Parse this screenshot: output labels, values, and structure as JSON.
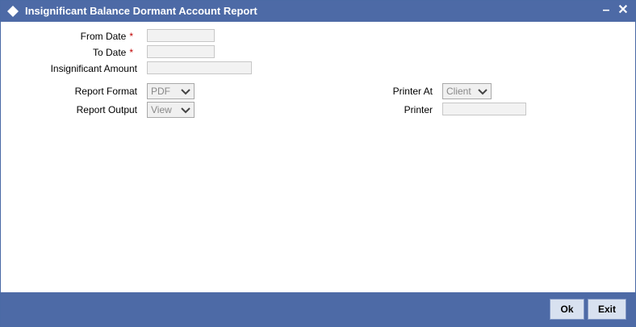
{
  "window": {
    "title": "Insignificant Balance Dormant Account Report",
    "minimize_glyph": "–",
    "close_glyph": "✕"
  },
  "form": {
    "from_date": {
      "label": "From Date",
      "required_mark": "*",
      "value": ""
    },
    "to_date": {
      "label": "To Date",
      "required_mark": "*",
      "value": ""
    },
    "insignificant_amount": {
      "label": "Insignificant Amount",
      "value": ""
    },
    "report_format": {
      "label": "Report Format",
      "selected": "PDF"
    },
    "report_output": {
      "label": "Report Output",
      "selected": "View"
    },
    "printer_at": {
      "label": "Printer At",
      "selected": "Client"
    },
    "printer": {
      "label": "Printer",
      "value": ""
    }
  },
  "footer": {
    "ok_label": "Ok",
    "exit_label": "Exit"
  },
  "colors": {
    "titlebar": "#4d6aa6",
    "footer": "#4d6aa6",
    "required": "#c00000"
  },
  "icons": {
    "title": "diamond-icon",
    "select_arrow": "chevron-down-icon"
  }
}
